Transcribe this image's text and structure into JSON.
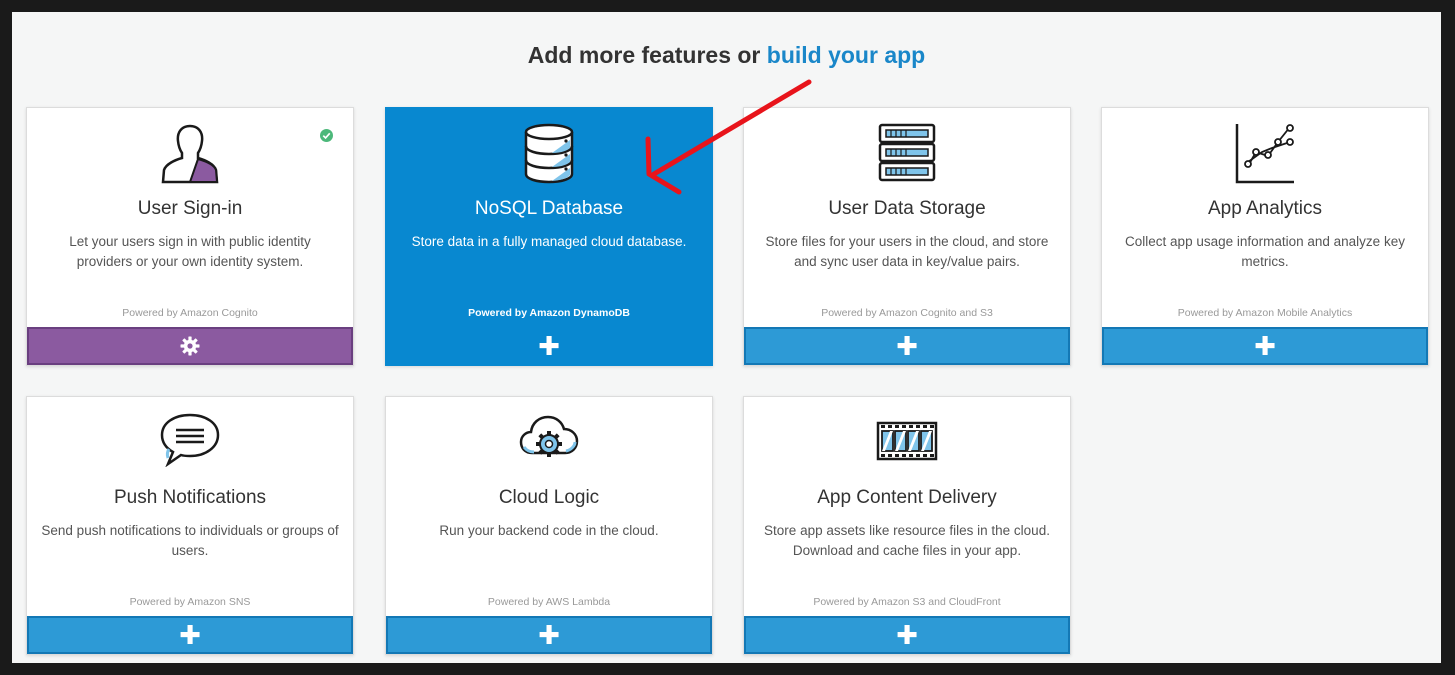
{
  "heading": {
    "text": "Add more features or ",
    "link": "build your app"
  },
  "cards": [
    {
      "title": "User Sign-in",
      "desc": "Let your users sign in with public identity providers or your own identity system.",
      "powered": "Powered by Amazon Cognito",
      "icon": "user-icon",
      "action_icon": "gear-icon",
      "added": true
    },
    {
      "title": "NoSQL Database",
      "desc": "Store data in a fully managed cloud database.",
      "powered": "Powered by Amazon DynamoDB",
      "icon": "database-icon",
      "action_icon": "plus-icon",
      "selected": true
    },
    {
      "title": "User Data Storage",
      "desc": "Store files for your users in the cloud, and store and sync user data in key/value pairs.",
      "powered": "Powered by Amazon Cognito and S3",
      "icon": "storage-icon",
      "action_icon": "plus-icon"
    },
    {
      "title": "App Analytics",
      "desc": "Collect app usage information and analyze key metrics.",
      "powered": "Powered by Amazon Mobile Analytics",
      "icon": "analytics-icon",
      "action_icon": "plus-icon"
    },
    {
      "title": "Push Notifications",
      "desc": "Send push notifications to individuals or groups of users.",
      "powered": "Powered by Amazon SNS",
      "icon": "chat-bubble-icon",
      "action_icon": "plus-icon"
    },
    {
      "title": "Cloud Logic",
      "desc": "Run your backend code in the cloud.",
      "powered": "Powered by AWS Lambda",
      "icon": "cloud-gear-icon",
      "action_icon": "plus-icon"
    },
    {
      "title": "App Content Delivery",
      "desc": "Store app assets like resource files in the cloud. Download and cache files in your app.",
      "powered": "Powered by Amazon S3 and CloudFront",
      "icon": "film-strip-icon",
      "action_icon": "plus-icon"
    }
  ],
  "symbols": {
    "plus": "✚"
  },
  "colors": {
    "accent": "#2d9ad6",
    "selected": "#0888d0",
    "added": "#8b5aa0",
    "link": "#1a87c9",
    "arrow": "#e8141b",
    "check": "#4cb87a"
  }
}
